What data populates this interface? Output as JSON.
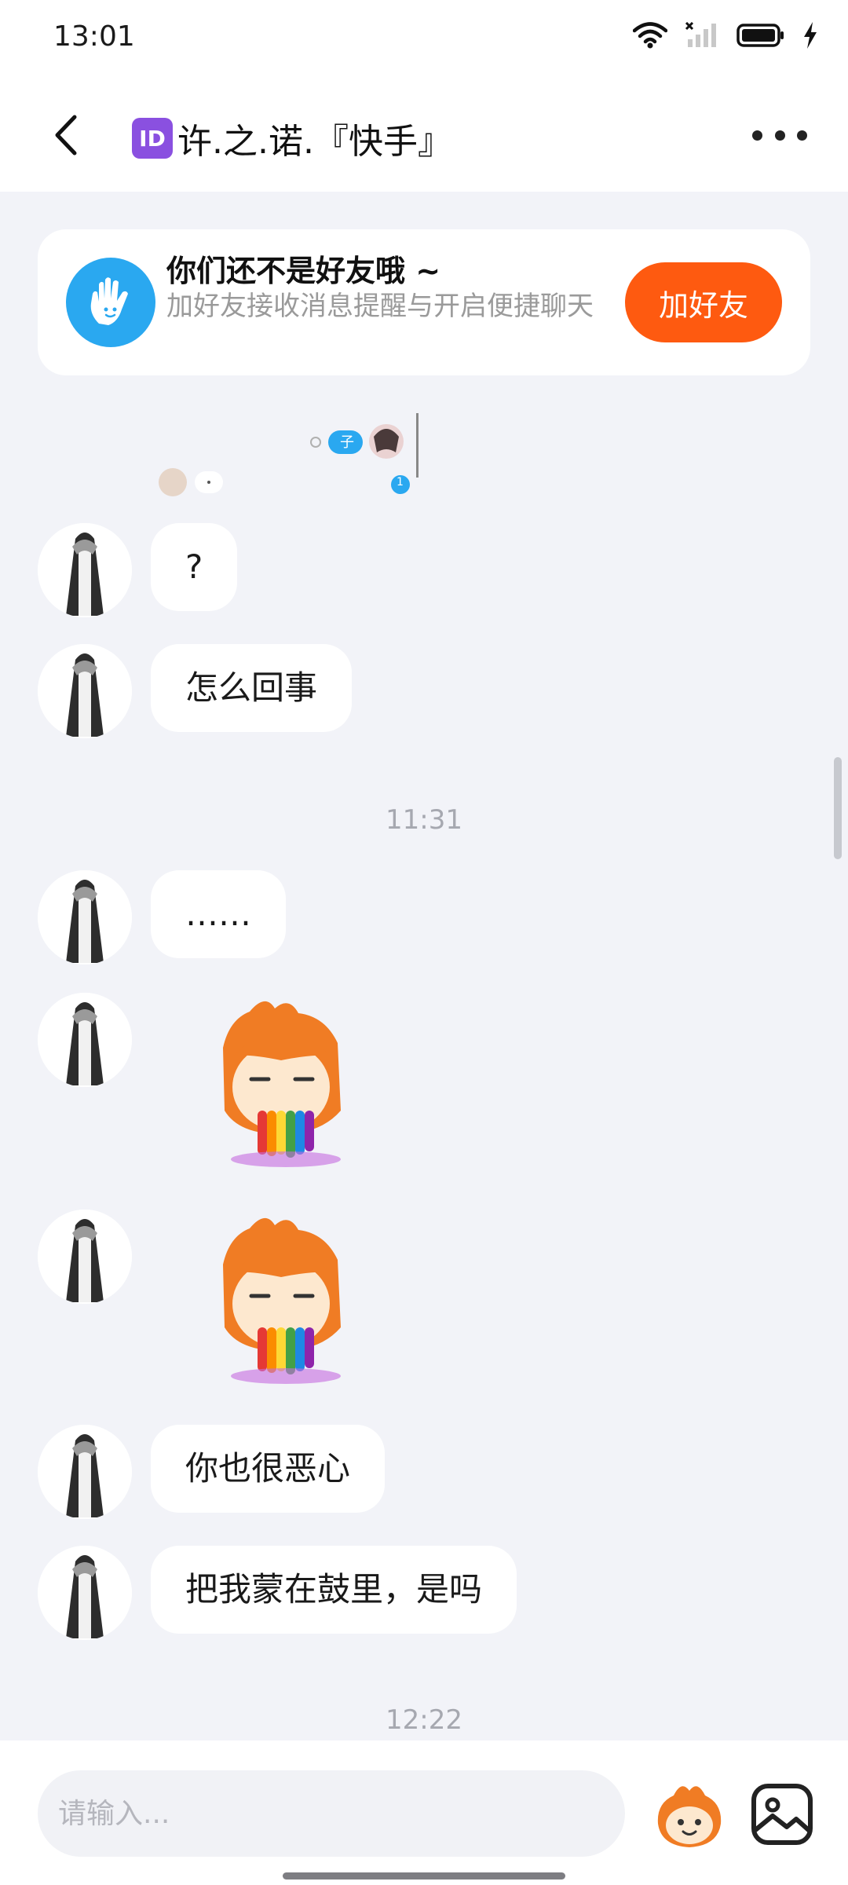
{
  "status_bar": {
    "time": "13:01",
    "icons": [
      "wifi-icon",
      "signal-icon",
      "battery-icon",
      "charging-icon"
    ]
  },
  "nav": {
    "back_icon": "chevron-left-icon",
    "id_badge": "ID",
    "title": "许.之.诺.『快手』",
    "more_icon": "more-icon"
  },
  "friend_prompt": {
    "title": "你们还不是好友哦 ~",
    "description": "加好友接收消息提醒与开启便捷聊天",
    "button": "加好友",
    "icon": "hand-wave-icon"
  },
  "mini_preview": {
    "badge_text": "子",
    "count": "1"
  },
  "messages": [
    {
      "type": "text",
      "text": "?"
    },
    {
      "type": "text",
      "text": "怎么回事"
    },
    {
      "type": "time",
      "text": "11:31"
    },
    {
      "type": "text",
      "text": "……"
    },
    {
      "type": "sticker",
      "name": "rainbow-vomit-sticker"
    },
    {
      "type": "sticker",
      "name": "rainbow-vomit-sticker"
    },
    {
      "type": "text",
      "text": "你也很恶心"
    },
    {
      "type": "text",
      "text": "把我蒙在鼓里，是吗"
    },
    {
      "type": "time",
      "text": "12:22"
    }
  ],
  "input": {
    "placeholder": "请输入...",
    "emoji_icon": "emoji-sticker-icon",
    "image_icon": "image-icon"
  },
  "colors": {
    "accent": "#fe5a10",
    "blue": "#2aa8f0",
    "badge": "#8a50e0",
    "background": "#f2f3f8"
  }
}
